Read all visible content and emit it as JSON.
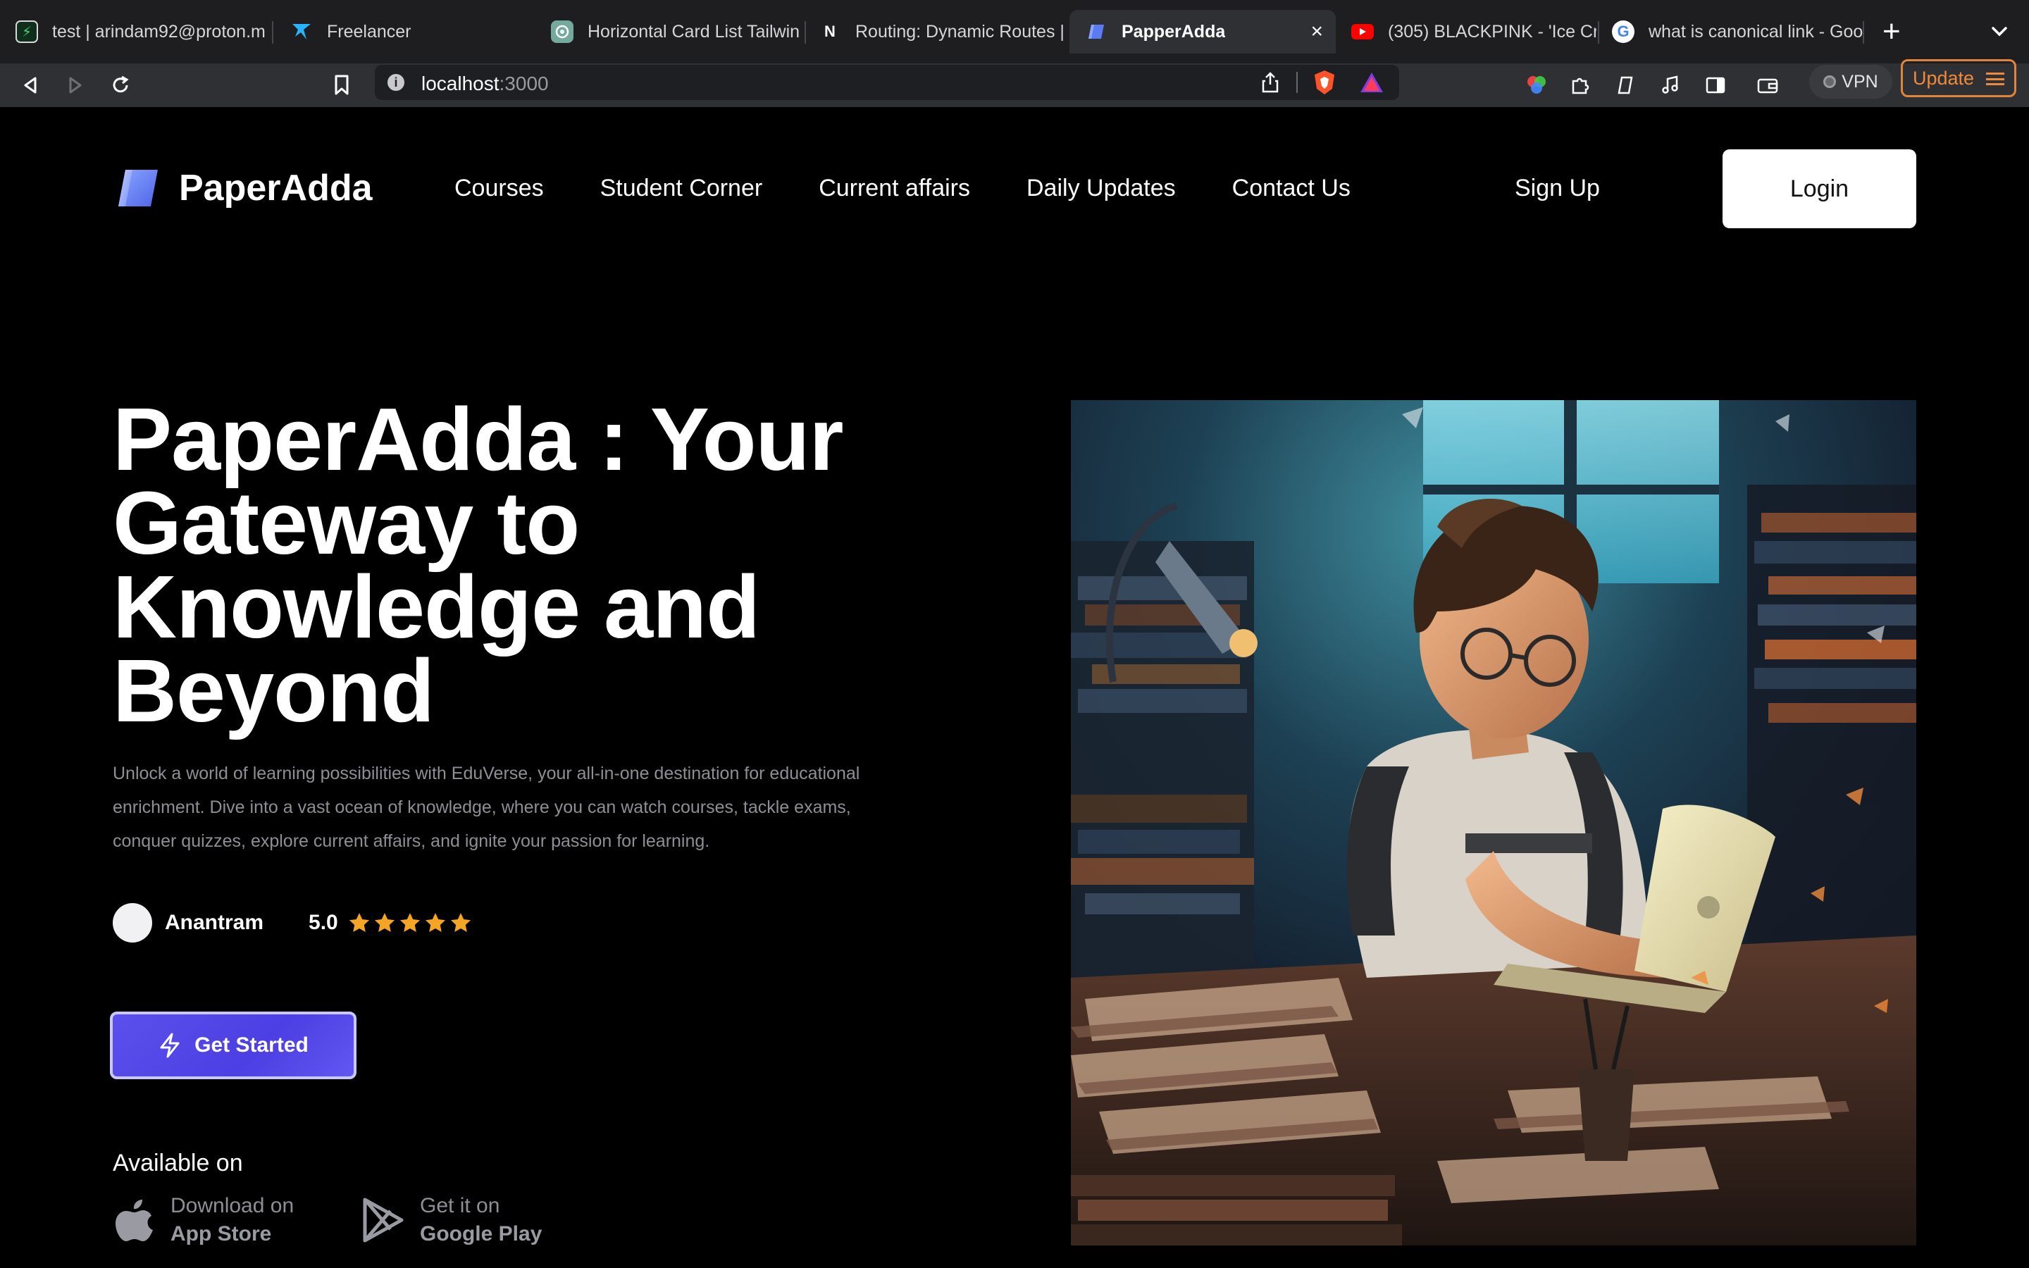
{
  "browser": {
    "tabs": [
      {
        "label": "test | arindam92@proton.m",
        "icon": "tab-app-icon"
      },
      {
        "label": "Freelancer",
        "icon": "freelancer-bird-icon"
      },
      {
        "label": "Horizontal Card List Tailwin",
        "icon": "chatgpt-icon"
      },
      {
        "label": "Routing: Dynamic Routes |",
        "icon": "nextjs-icon"
      },
      {
        "label": "PapperAdda",
        "icon": "paperadda-icon",
        "active": true
      },
      {
        "label": "(305) BLACKPINK - 'Ice Cr",
        "icon": "youtube-icon"
      },
      {
        "label": "what is canonical link - Goo",
        "icon": "google-icon"
      }
    ],
    "url_host": "localhost",
    "url_port": ":3000",
    "vpn_label": "VPN",
    "update_label": "Update"
  },
  "site": {
    "brand": "PaperAdda",
    "nav": [
      "Courses",
      "Student Corner",
      "Current affairs",
      "Daily Updates",
      "Contact Us"
    ],
    "signup": "Sign Up",
    "login": "Login"
  },
  "hero": {
    "title": "PaperAdda : Your Gateway to Knowledge and Beyond",
    "description": "Unlock a world of learning possibilities with EduVerse, your all-in-one destination for educational enrichment. Dive into a vast ocean of knowledge, where you can watch courses, tackle exams, conquer quizzes, explore current affairs, and ignite your passion for learning.",
    "reviewer": "Anantram",
    "rating": "5.0",
    "stars": 5,
    "cta": "Get Started",
    "available_on": "Available on",
    "app_store": {
      "line1": "Download on",
      "line2": "App Store"
    },
    "google_play": {
      "line1": "Get it on",
      "line2": "Google Play"
    }
  },
  "colors": {
    "accent": "#5046e5",
    "star": "#f5a524",
    "update": "#f08a3b"
  }
}
